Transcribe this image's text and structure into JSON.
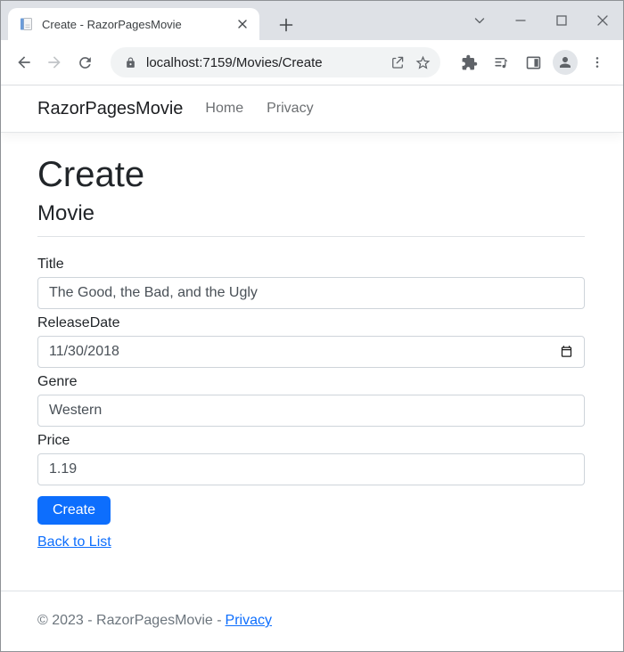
{
  "browser": {
    "tab": {
      "title": "Create - RazorPagesMovie"
    },
    "url": "localhost:7159/Movies/Create",
    "icons": {
      "tab_favicon": "document-with-blue-bar",
      "toolbar_left": [
        "back-arrow",
        "forward-arrow",
        "reload"
      ],
      "omnibox": [
        "lock",
        "share",
        "star"
      ],
      "toolbar_right": [
        "extensions-puzzle",
        "media-controls",
        "side-panel",
        "profile-avatar",
        "more-vertical-dots"
      ],
      "window_controls": [
        "tab-search-chevron",
        "minimize",
        "maximize",
        "close"
      ]
    }
  },
  "site": {
    "navbar": {
      "brand": "RazorPagesMovie",
      "links": [
        {
          "label": "Home"
        },
        {
          "label": "Privacy"
        }
      ]
    },
    "page": {
      "heading": "Create",
      "subheading": "Movie"
    },
    "form": {
      "fields": [
        {
          "label": "Title",
          "value": "The Good, the Bad, and the Ugly",
          "type": "text"
        },
        {
          "label": "ReleaseDate",
          "value": "11/30/2018",
          "type": "date"
        },
        {
          "label": "Genre",
          "value": "Western",
          "type": "text"
        },
        {
          "label": "Price",
          "value": "1.19",
          "type": "text"
        }
      ],
      "submit_label": "Create",
      "back_link_label": "Back to List"
    },
    "footer": {
      "text": "© 2023 - RazorPagesMovie -",
      "link_label": "Privacy"
    }
  },
  "colors": {
    "primary": "#0d6efd",
    "titlebar_bg": "#dee1e6",
    "omnibox_bg": "#f1f3f4",
    "muted_text": "#6c757d"
  }
}
